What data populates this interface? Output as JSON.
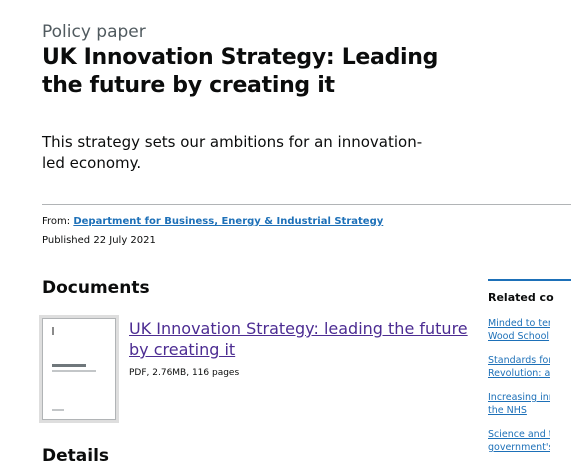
{
  "header": {
    "caption": "Policy paper",
    "title": "UK Innovation Strategy: Leading the future by creating it",
    "lead": "This strategy sets our ambitions for an innovation-led economy."
  },
  "metadata": {
    "from_label": "From:",
    "organisation": "Department for Business, Energy & Industrial Strategy",
    "published_label": "Published",
    "published_date": "22 July 2021"
  },
  "documents": {
    "heading": "Documents",
    "items": [
      {
        "title": "UK Innovation Strategy: leading the future by creating it",
        "meta": "PDF, 2.76MB, 116 pages"
      }
    ]
  },
  "details": {
    "heading": "Details"
  },
  "related": {
    "heading": "Related co",
    "links": [
      {
        "line1": "Minded to ter",
        "line2": "Wood School"
      },
      {
        "line1": "Standards for",
        "line2": "Revolution: a"
      },
      {
        "line1": "Increasing inr",
        "line2": "the NHS"
      },
      {
        "line1": "Science and t",
        "line2": "government's"
      }
    ]
  },
  "colors": {
    "link": "#1d70b8",
    "visited_link": "#4c2c92",
    "text": "#0b0c0c",
    "secondary_text": "#505a5f",
    "rule": "#b1b4b6"
  }
}
